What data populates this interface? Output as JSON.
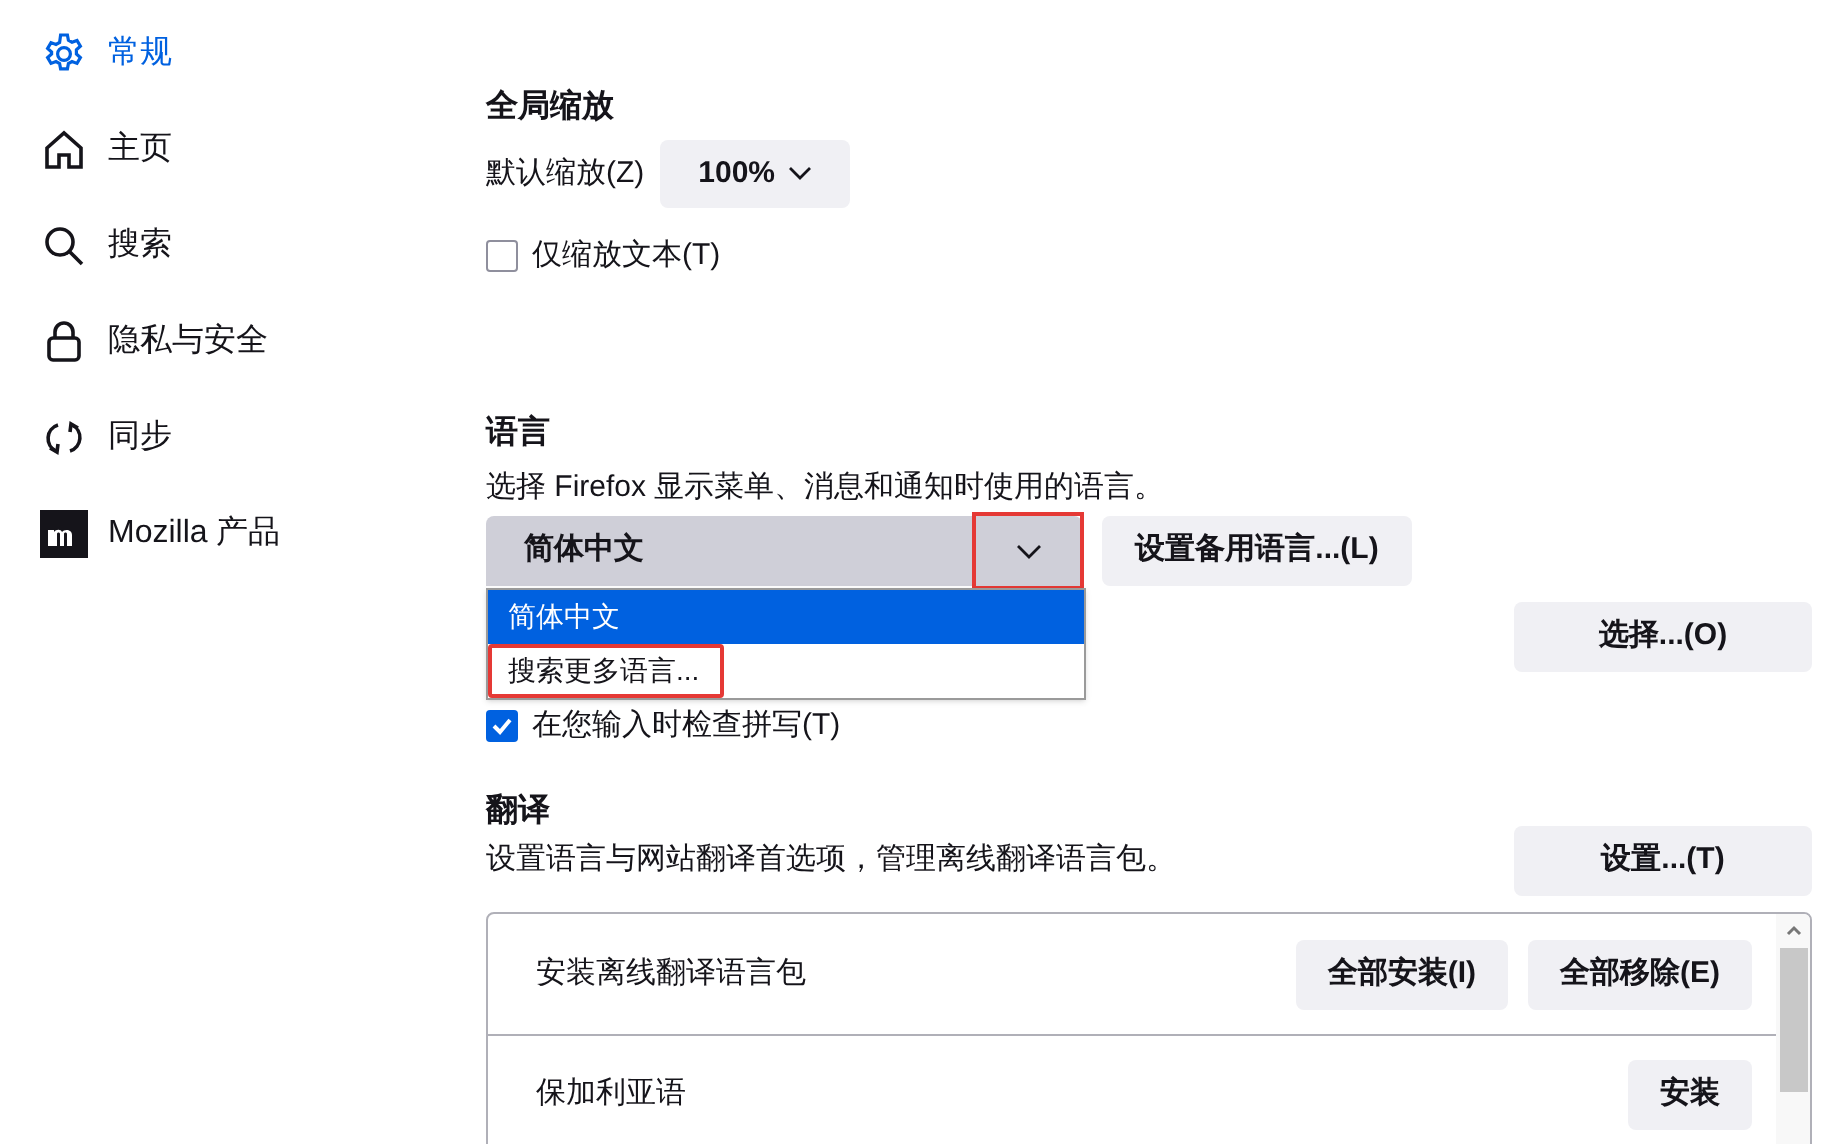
{
  "sidebar": {
    "items": [
      {
        "label": "常规",
        "selected": true
      },
      {
        "label": "主页",
        "selected": false
      },
      {
        "label": "搜索",
        "selected": false
      },
      {
        "label": "隐私与安全",
        "selected": false
      },
      {
        "label": "同步",
        "selected": false
      },
      {
        "label": "Mozilla 产品",
        "selected": false
      }
    ]
  },
  "zoom": {
    "heading": "全局缩放",
    "label": "默认缩放(Z)",
    "value": "100%",
    "text_only": {
      "label": "仅缩放文本(T)",
      "checked": false
    }
  },
  "language": {
    "heading": "语言",
    "description": "选择 Firefox 显示菜单、消息和通知时使用的语言。",
    "select": {
      "value": "简体中文",
      "expanded": true,
      "arrow_highlighted": true,
      "options": [
        {
          "label": "简体中文",
          "selected": true,
          "highlighted": false
        },
        {
          "label": "搜索更多语言...",
          "selected": false,
          "highlighted": true
        }
      ]
    },
    "alternatives_button": "设置备用语言...(L)",
    "choose_button": "选择...(O)",
    "spellcheck": {
      "label": "在您输入时检查拼写(T)",
      "checked": true
    }
  },
  "translation": {
    "heading": "翻译",
    "description": "设置语言与网站翻译首选项，管理离线翻译语言包。",
    "settings_button": "设置...(T)",
    "rows": [
      {
        "label": "安装离线翻译语言包",
        "buttons": [
          "全部安装(I)",
          "全部移除(E)"
        ]
      },
      {
        "label": "保加利亚语",
        "buttons": [
          "安装"
        ]
      }
    ]
  }
}
